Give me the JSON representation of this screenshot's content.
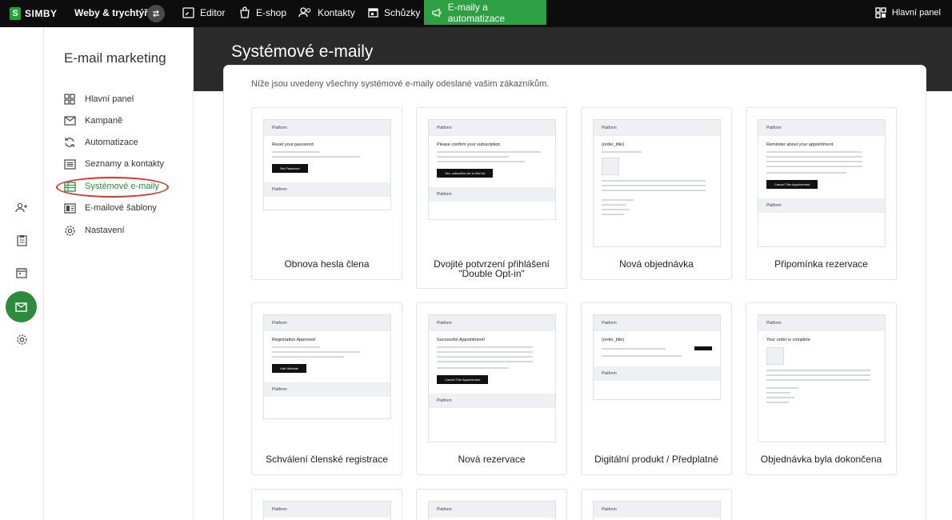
{
  "topbar": {
    "logo_letter": "S",
    "logo_text": "SIMBY",
    "site_name": "Weby & trychtýře",
    "nav": [
      {
        "label": "Editor",
        "icon": "editor-icon"
      },
      {
        "label": "E-shop",
        "icon": "shop-bag-icon"
      },
      {
        "label": "Kontakty",
        "icon": "contacts-icon"
      },
      {
        "label": "Schůzky",
        "icon": "calendar-icon"
      },
      {
        "label": "E-maily a automatizace",
        "icon": "megaphone-icon",
        "active": true
      }
    ],
    "dashboard_label": "Hlavní panel"
  },
  "sidebar": {
    "title": "E-mail marketing",
    "items": [
      {
        "label": "Hlavní panel",
        "icon": "dashboard-icon"
      },
      {
        "label": "Kampaně",
        "icon": "envelope-icon"
      },
      {
        "label": "Automatizace",
        "icon": "refresh-icon"
      },
      {
        "label": "Seznamy a kontakty",
        "icon": "list-icon"
      },
      {
        "label": "Systémové e-maily",
        "icon": "table-icon",
        "active": true
      },
      {
        "label": "E-mailové šablony",
        "icon": "template-icon"
      },
      {
        "label": "Nastavení",
        "icon": "gear-icon"
      }
    ]
  },
  "main": {
    "title": "Systémové e-maily",
    "description": "Níže jsou uvedeny všechny systémové e-maily odeslané vašim zákazníkům.",
    "cards": [
      {
        "label": "Obnova hesla člena",
        "thumb_title": "Reset your password",
        "thumb_btn": "Set Password"
      },
      {
        "label": "Dvojité potvrzení přihlášení \"Double Opt-in\"",
        "thumb_title": "Please confirm your subscription",
        "thumb_btn": "Yes, subscribe me to this list"
      },
      {
        "label": "Nová objednávka",
        "thumb_title": "{order_title}",
        "thumb_btn": ""
      },
      {
        "label": "Připomínka rezervace",
        "thumb_title": "Reminder about your appointment",
        "thumb_btn": "Cancel This Appointment"
      },
      {
        "label": "Schválení členské registrace",
        "thumb_title": "Registration Approved",
        "thumb_btn": "Visit Website"
      },
      {
        "label": "Nová rezervace",
        "thumb_title": "Successful Appointment!",
        "thumb_btn": "Cancel This Appointment"
      },
      {
        "label": "Digitální produkt / Předplatné",
        "thumb_title": "{order_title}",
        "thumb_btn": ""
      },
      {
        "label": "Objednávka byla dokončena",
        "thumb_title": "Your order is complete",
        "thumb_btn": ""
      }
    ],
    "thumb_brand": "Platform"
  },
  "colors": {
    "accent_green": "#2ea043",
    "topbar_bg": "#0d0d0d",
    "header_bg": "#2b2b2b",
    "annotation_red": "#d9342b"
  }
}
